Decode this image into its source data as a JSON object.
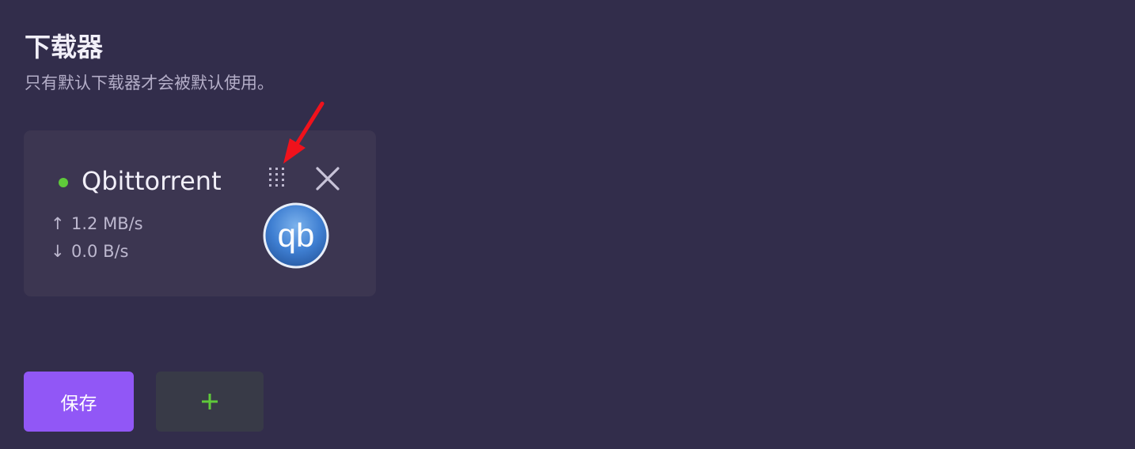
{
  "section": {
    "title": "下载器",
    "subtitle": "只有默认下载器才会被默认使用。"
  },
  "downloader": {
    "name": "Qbittorrent",
    "status_color": "#5fca3a",
    "upload_arrow": "↑",
    "upload_speed": "1.2 MB/s",
    "download_arrow": "↓",
    "download_speed": "0.0 B/s",
    "logo_text": "qb",
    "icons": [
      "status-dot",
      "drag-handle-icon",
      "close-icon",
      "qbittorrent-logo"
    ]
  },
  "actions": {
    "save_label": "保存",
    "add_icon": "plus-icon"
  },
  "colors": {
    "background": "#322d4b",
    "card": "#3c3651",
    "accent": "#9157f6",
    "add_button": "#383a47",
    "plus": "#5fca3a",
    "annotation_arrow": "#f0121c"
  }
}
